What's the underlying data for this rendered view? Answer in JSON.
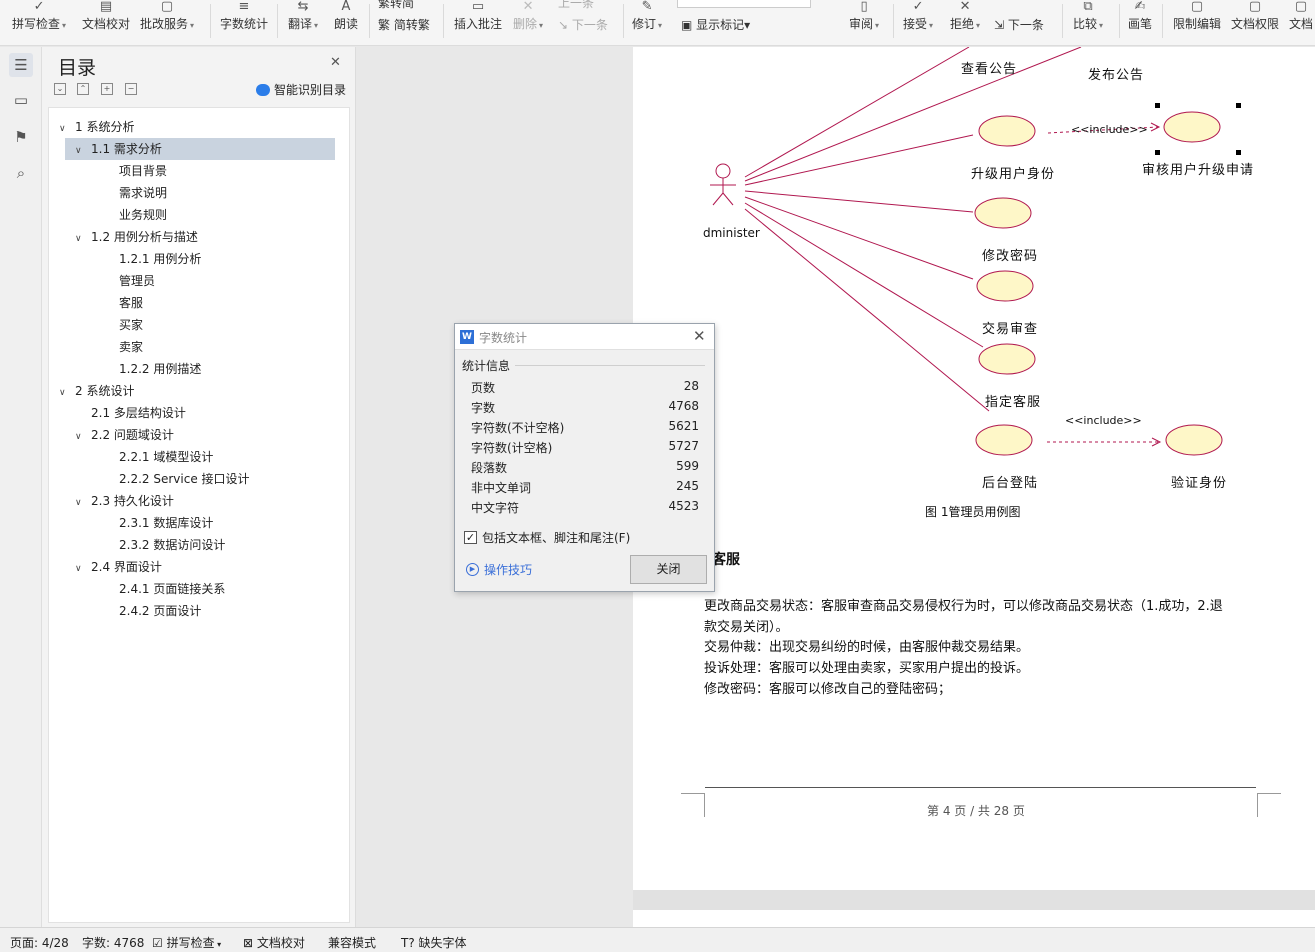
{
  "ribbon": {
    "spell_check": "拼写检查",
    "doc_proof": "文档校对",
    "review_service": "批改服务",
    "word_count": "字数统计",
    "translate": "翻译",
    "read_aloud": "朗读",
    "simp_to_trad": "繁转简",
    "trad_to_simp": "简转繁",
    "insert_comment": "插入批注",
    "delete": "删除",
    "prev": "上一条",
    "next_comment": "下一条",
    "revise": "修订",
    "show_markup": "显示标记",
    "review": "审阅",
    "accept": "接受",
    "reject": "拒绝",
    "next": "下一条",
    "compare": "比较",
    "pen": "画笔",
    "restrict_edit": "限制编辑",
    "doc_permission": "文档权限",
    "doc_more": "文档"
  },
  "toc": {
    "title": "目录",
    "smart_label": "智能识别目录",
    "items": [
      {
        "label": "1  系统分析",
        "level": 0,
        "expanded": true
      },
      {
        "label": "1.1 需求分析",
        "level": 1,
        "expanded": true,
        "selected": true
      },
      {
        "label": "项目背景",
        "level": 2
      },
      {
        "label": "需求说明",
        "level": 2
      },
      {
        "label": "业务规则",
        "level": 2
      },
      {
        "label": "1.2  用例分析与描述",
        "level": 1,
        "expanded": true
      },
      {
        "label": "1.2.1  用例分析",
        "level": 2
      },
      {
        "label": "管理员",
        "level": 2
      },
      {
        "label": "客服",
        "level": 2
      },
      {
        "label": "买家",
        "level": 2
      },
      {
        "label": "卖家",
        "level": 2
      },
      {
        "label": "1.2.2  用例描述",
        "level": 2
      },
      {
        "label": "2  系统设计",
        "level": 0,
        "expanded": true
      },
      {
        "label": "2.1  多层结构设计",
        "level": 1
      },
      {
        "label": "2.2  问题域设计",
        "level": 1,
        "expanded": true
      },
      {
        "label": "2.2.1  域模型设计",
        "level": 2
      },
      {
        "label": "2.2.2    Service 接口设计",
        "level": 2
      },
      {
        "label": "2.3  持久化设计",
        "level": 1,
        "expanded": true
      },
      {
        "label": "2.3.1  数据库设计",
        "level": 2
      },
      {
        "label": "2.3.2  数据访问设计",
        "level": 2
      },
      {
        "label": "2.4  界面设计",
        "level": 1,
        "expanded": true
      },
      {
        "label": "2.4.1  页面链接关系",
        "level": 2
      },
      {
        "label": "2.4.2  页面设计",
        "level": 2
      }
    ]
  },
  "diagram": {
    "actor": "dminister",
    "include1": "<<include>>",
    "include2": "<<include>>",
    "uc_view": "查看公告",
    "uc_publish": "发布公告",
    "uc_upgrade": "升级用户身份",
    "uc_audit": "审核用户升级申请",
    "uc_password": "修改密码",
    "uc_trade": "交易审查",
    "uc_assign": "指定客服",
    "uc_login": "后台登陆",
    "uc_verify": "验证身份",
    "caption": "图  1管理员用例图",
    "line_color": "#b0174f",
    "ellipse_fill": "#fef7c8"
  },
  "doc": {
    "heading": "客服",
    "para1_line1": "更改商品交易状态：客服审查商品交易侵权行为时，可以修改商品交易状态（1.成功，2.退",
    "para1_line2": "款交易关闭）。",
    "para2": "交易仲裁：出现交易纠纷的时候，由客服仲裁交易结果。",
    "para3": "投诉处理：客服可以处理由卖家，买家用户提出的投诉。",
    "para4": "修改密码：客服可以修改自己的登陆密码；",
    "page_footer": "第 4 页 / 共 28 页"
  },
  "dialog": {
    "title": "字数统计",
    "section": "统计信息",
    "stats": [
      {
        "k": "页数",
        "v": "28"
      },
      {
        "k": "字数",
        "v": "4768"
      },
      {
        "k": "字符数(不计空格)",
        "v": "5621"
      },
      {
        "k": "字符数(计空格)",
        "v": "5727"
      },
      {
        "k": "段落数",
        "v": "599"
      },
      {
        "k": "非中文单词",
        "v": "245"
      },
      {
        "k": "中文字符",
        "v": "4523"
      }
    ],
    "checkbox_label": "包括文本框、脚注和尾注(F)",
    "tips": "操作技巧",
    "close": "关闭"
  },
  "status": {
    "page": "页面: 4/28",
    "words": "字数: 4768",
    "spell": "拼写检查",
    "proof": "文档校对",
    "compat": "兼容模式",
    "missing_font": "缺失字体"
  }
}
